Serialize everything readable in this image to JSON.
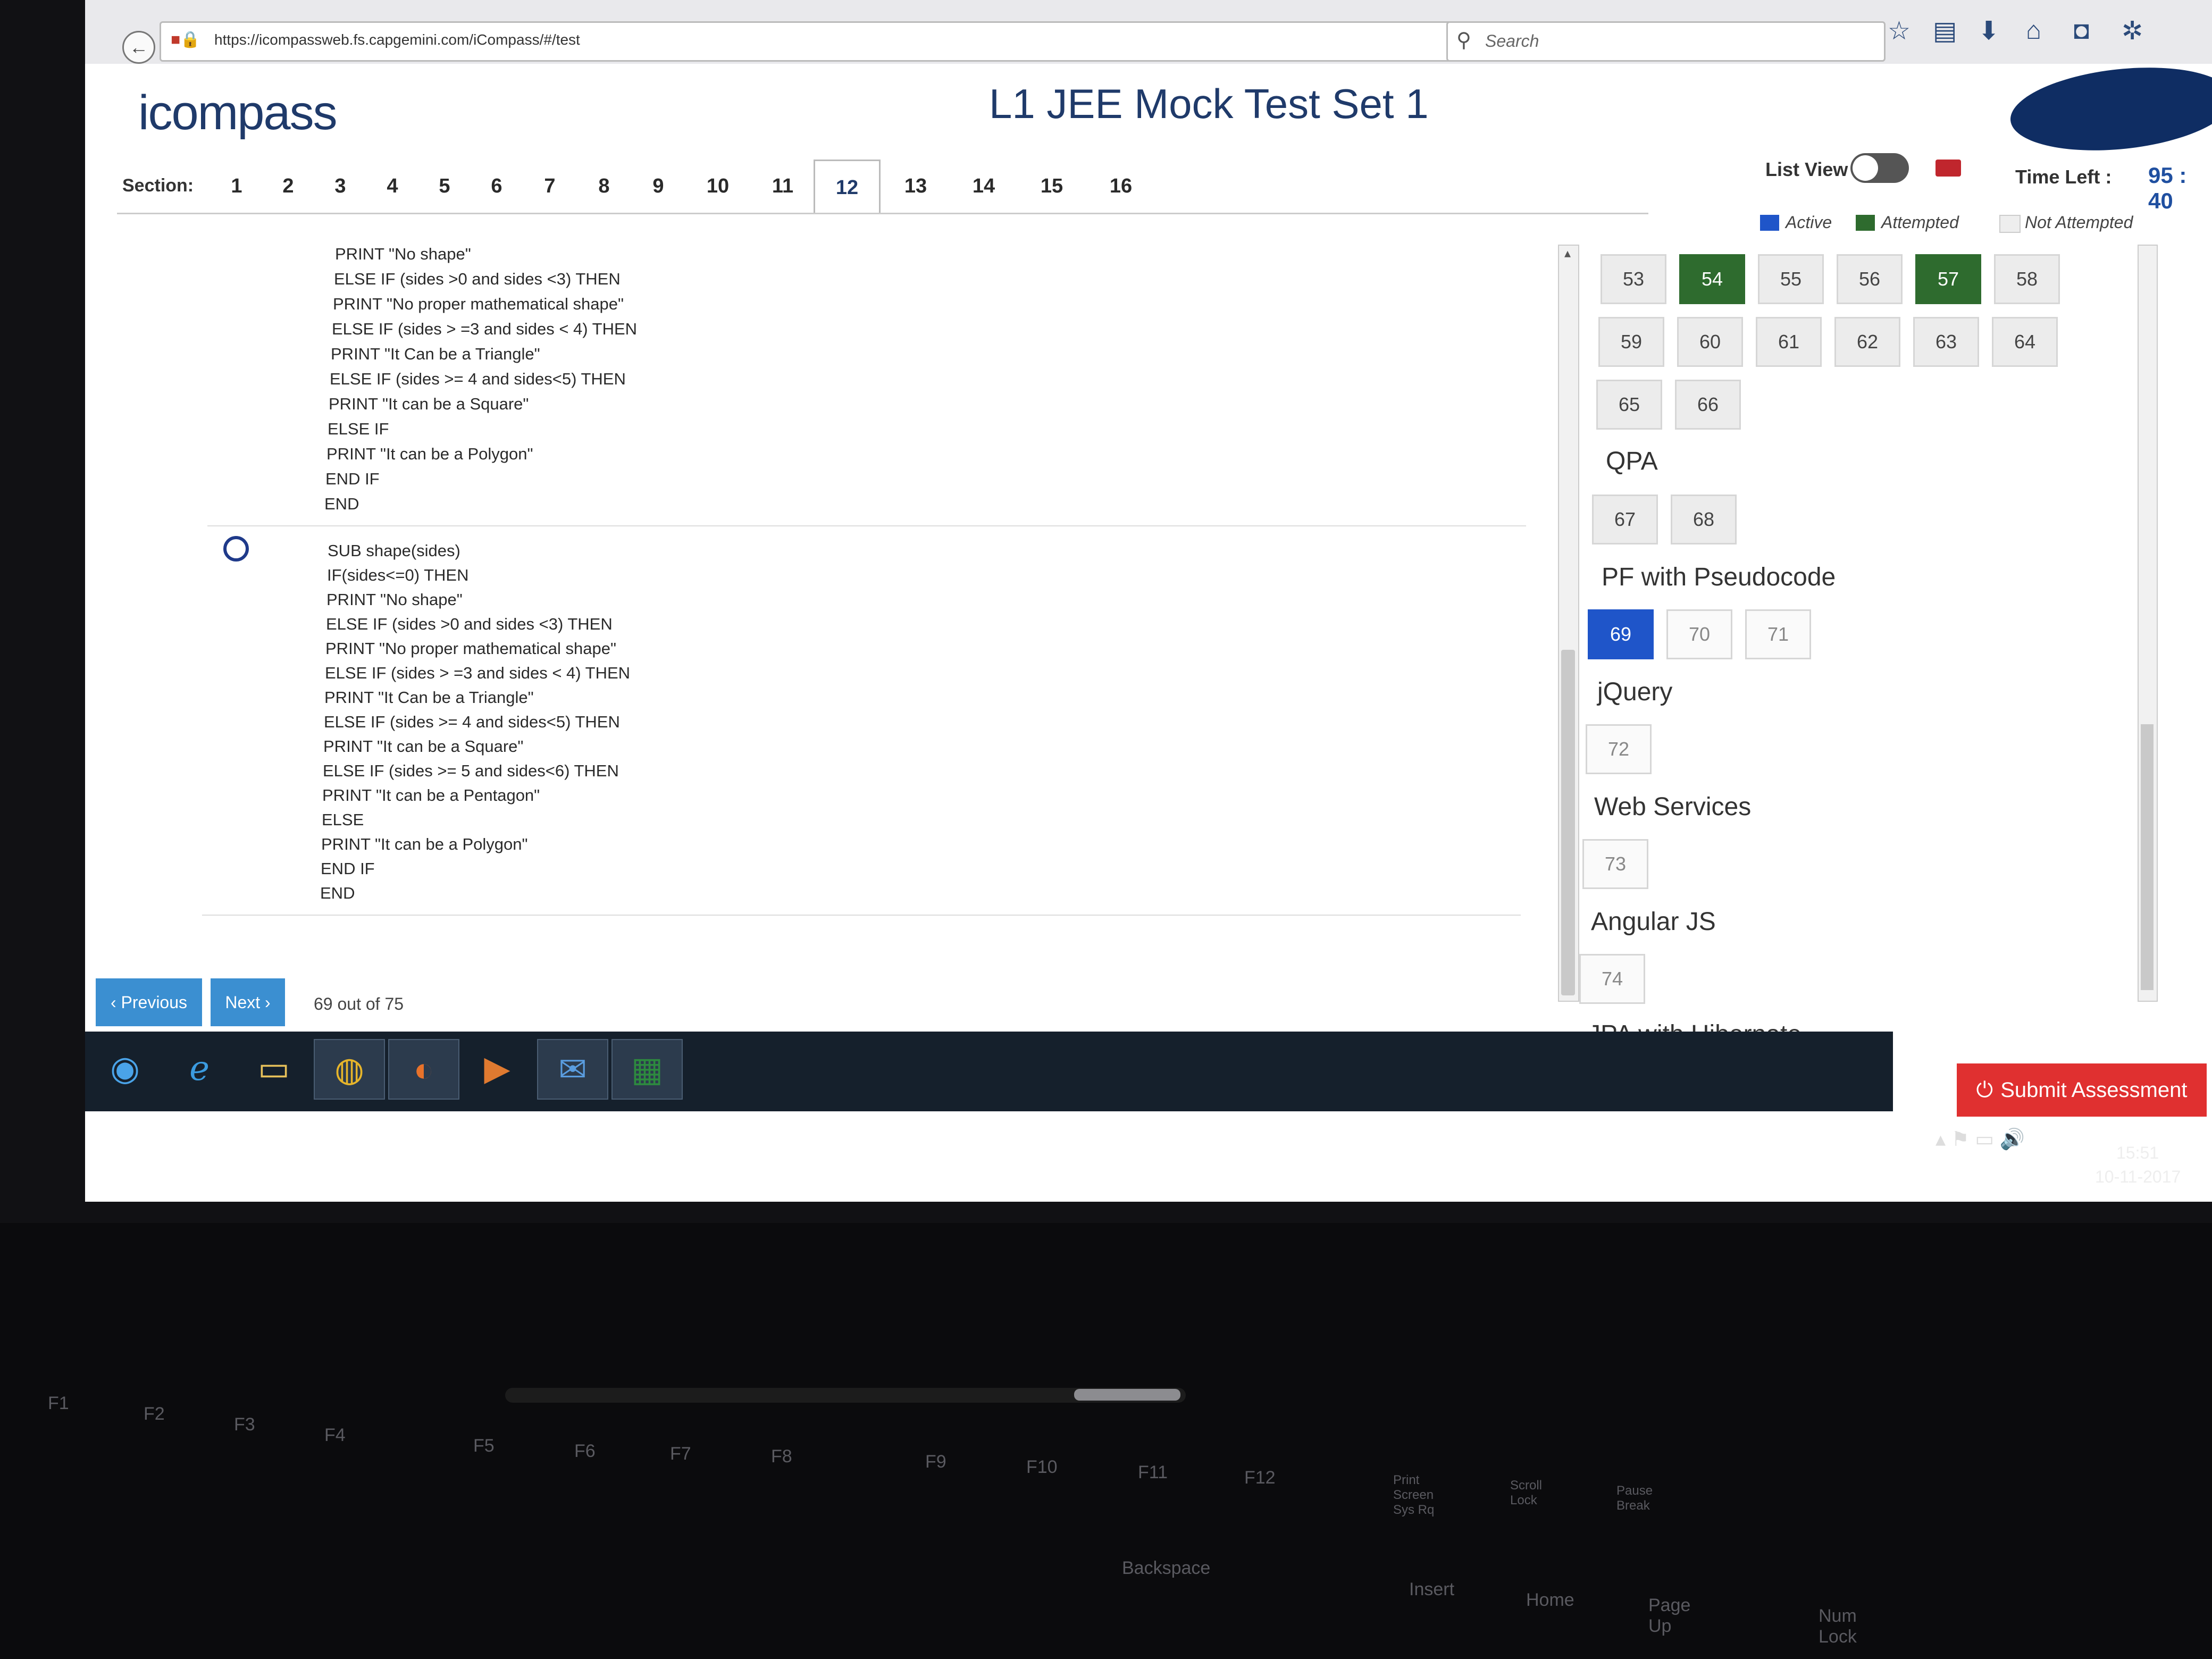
{
  "browser": {
    "url": "https://icompassweb.fs.capgemini.com/iCompass/#/test",
    "search_placeholder": "Search"
  },
  "app": {
    "logo": "icompass",
    "title": "L1 JEE Mock Test Set 1",
    "section_label": "Section:",
    "sections": [
      "1",
      "2",
      "3",
      "4",
      "5",
      "6",
      "7",
      "8",
      "9",
      "10",
      "11",
      "12",
      "13",
      "14",
      "15",
      "16"
    ],
    "active_section": "12",
    "list_view_label": "List View",
    "time_left_label": "Time Left :",
    "time_left_value": "95 : 40"
  },
  "question": {
    "option_a_lines": [
      "PRINT \"No shape\"",
      "ELSE IF (sides >0 and sides <3) THEN",
      "PRINT \"No proper mathematical shape\"",
      "ELSE IF (sides > =3 and sides < 4) THEN",
      "PRINT \"It Can be a Triangle\"",
      "ELSE IF (sides >= 4 and sides<5) THEN",
      "PRINT \"It can be a Square\"",
      "ELSE IF",
      "PRINT \"It can be a Polygon\"",
      "END IF",
      "END"
    ],
    "option_b_lines": [
      "SUB shape(sides)",
      "IF(sides<=0) THEN",
      "PRINT \"No shape\"",
      "ELSE IF (sides >0 and sides <3) THEN",
      "PRINT \"No proper mathematical shape\"",
      "ELSE IF (sides > =3 and sides < 4) THEN",
      "PRINT \"It Can be a Triangle\"",
      "ELSE IF (sides >= 4 and sides<5) THEN",
      "PRINT \"It can be a Square\"",
      "ELSE IF (sides >= 5 and sides<6) THEN",
      "PRINT \"It can be a Pentagon\"",
      "ELSE",
      "PRINT \"It can be a Polygon\"",
      "END IF",
      "END"
    ]
  },
  "nav": {
    "previous": "‹ Previous",
    "next": "Next ›",
    "counter": "69 out of 75"
  },
  "legend": {
    "active": "Active",
    "attempted": "Attempted",
    "not_attempted": "Not Attempted",
    "active_color": "#1f55c9",
    "attempted_color": "#2e6b2e"
  },
  "palette": {
    "row1": [
      {
        "n": "53",
        "state": "not-attempted"
      },
      {
        "n": "54",
        "state": "attempted"
      },
      {
        "n": "55",
        "state": "not-attempted"
      },
      {
        "n": "56",
        "state": "not-attempted"
      },
      {
        "n": "57",
        "state": "attempted"
      },
      {
        "n": "58",
        "state": "not-attempted"
      }
    ],
    "row2": [
      "59",
      "60",
      "61",
      "62",
      "63",
      "64"
    ],
    "row3": [
      "65",
      "66"
    ],
    "categories": {
      "qpa": {
        "name": "QPA",
        "questions": [
          "67",
          "68"
        ]
      },
      "pf": {
        "name": "PF with Pseudocode",
        "questions": [
          "69",
          "70",
          "71"
        ]
      },
      "jquery": {
        "name": "jQuery",
        "questions": [
          "72"
        ]
      },
      "ws": {
        "name": "Web Services",
        "questions": [
          "73"
        ]
      },
      "angular": {
        "name": "Angular JS",
        "questions": [
          "74"
        ]
      },
      "jpa": {
        "name": "JPA with Hibernate"
      }
    }
  },
  "submit_label": "Submit Assessment",
  "taskbar": {
    "apps": [
      "start-orb",
      "internet-explorer",
      "file-explorer",
      "chrome",
      "firefox",
      "media-player",
      "outlook",
      "excel"
    ]
  },
  "tray": {
    "time": "15:51",
    "date": "10-11-2017"
  },
  "keyboard": {
    "keys": [
      "F1",
      "F2",
      "F3",
      "F4",
      "F5",
      "F6",
      "F7",
      "F8",
      "F9",
      "F10",
      "F11",
      "F12",
      "Print Screen Sys Rq",
      "Scroll Lock",
      "Pause Break",
      "Backspace",
      "Insert",
      "Home",
      "Page Up",
      "Num Lock"
    ]
  }
}
